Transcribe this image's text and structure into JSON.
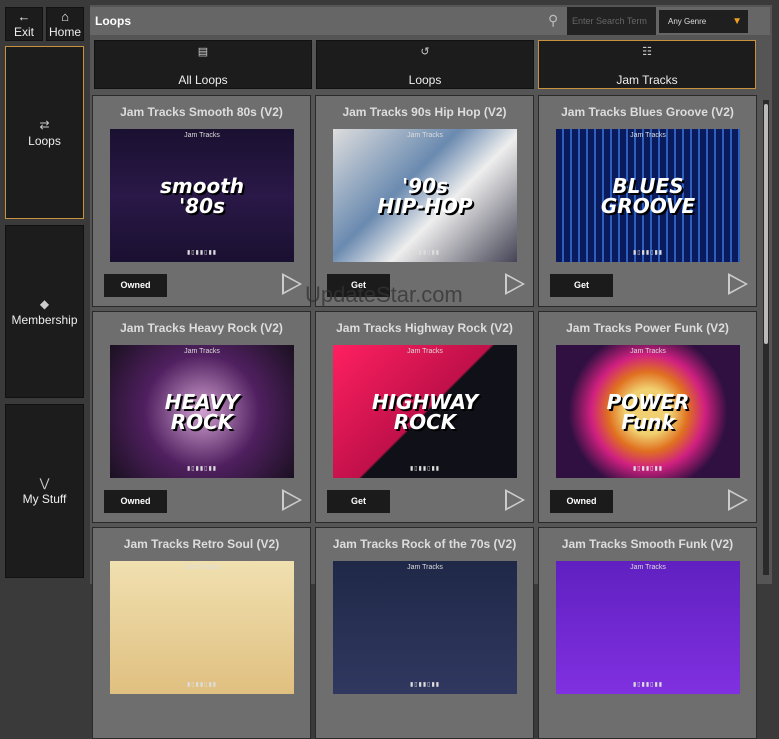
{
  "nav": {
    "exit": "Exit",
    "home": "Home"
  },
  "sidebar": [
    {
      "label": "Loops",
      "icon": "loops-icon"
    },
    {
      "label": "Membership",
      "icon": "tag-icon"
    },
    {
      "label": "My Stuff",
      "icon": "chevrons-down-icon"
    }
  ],
  "header": {
    "title": "Loops",
    "search_placeholder": "Enter Search Term",
    "genre": "Any Genre"
  },
  "tabs": [
    {
      "label": "All Loops"
    },
    {
      "label": "Loops"
    },
    {
      "label": "Jam Tracks"
    }
  ],
  "cards": [
    {
      "title": "Jam Tracks Smooth 80s (V2)",
      "art": "smooth\n'80s",
      "brand": "Jam Tracks",
      "button": "Owned"
    },
    {
      "title": "Jam Tracks 90s Hip Hop (V2)",
      "art": "'90s\nHIP-HOP",
      "brand": "Jam Tracks",
      "button": "Get"
    },
    {
      "title": "Jam Tracks Blues Groove (V2)",
      "art": "BLUES\nGROOVE",
      "brand": "Jam Tracks",
      "button": "Get"
    },
    {
      "title": "Jam Tracks Heavy Rock (V2)",
      "art": "HEAVY\nROCK",
      "brand": "Jam Tracks",
      "button": "Owned"
    },
    {
      "title": "Jam Tracks Highway Rock (V2)",
      "art": "HIGHWAY\nROCK",
      "brand": "Jam Tracks",
      "button": "Get"
    },
    {
      "title": "Jam Tracks Power Funk (V2)",
      "art": "POWER\nFunk",
      "brand": "Jam Tracks",
      "button": "Owned"
    },
    {
      "title": "Jam Tracks Retro Soul (V2)",
      "art": "",
      "brand": "Jam Tracks",
      "button": ""
    },
    {
      "title": "Jam Tracks Rock of the 70s (V2)",
      "art": "",
      "brand": "Jam Tracks",
      "button": ""
    },
    {
      "title": "Jam Tracks Smooth Funk (V2)",
      "art": "",
      "brand": "Jam Tracks",
      "button": ""
    }
  ],
  "watermark": "UpdateStar.com"
}
